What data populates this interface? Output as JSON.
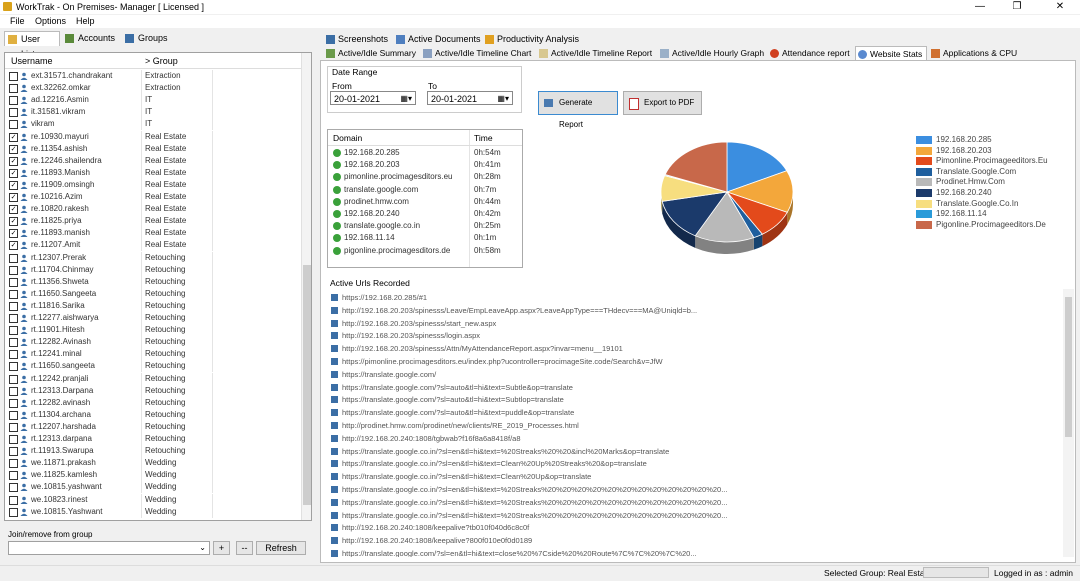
{
  "window": {
    "title": "WorkTrak - On Premises- Manager [ Licensed ]",
    "min": "—",
    "max": "❐",
    "close": "✕"
  },
  "menu": [
    "File",
    "Options",
    "Help"
  ],
  "left_tabs": [
    "User List",
    "Accounts",
    "Groups"
  ],
  "user_list": {
    "columns": [
      "Username",
      "> Group"
    ],
    "rows": [
      {
        "name": "ext.31571.chandrakant",
        "group": "Extraction",
        "checked": false
      },
      {
        "name": "ext.32262.omkar",
        "group": "Extraction",
        "checked": false
      },
      {
        "name": "ad.12216.Asmin",
        "group": "IT",
        "checked": false
      },
      {
        "name": "it.31581.vikram",
        "group": "IT",
        "checked": false
      },
      {
        "name": "vikram",
        "group": "IT",
        "checked": false
      },
      {
        "name": "re.10930.mayuri",
        "group": "Real Estate",
        "checked": true
      },
      {
        "name": "re.11354.ashish",
        "group": "Real Estate",
        "checked": true
      },
      {
        "name": "re.12246.shailendra",
        "group": "Real Estate",
        "checked": true
      },
      {
        "name": "re.11893.Manish",
        "group": "Real Estate",
        "checked": true
      },
      {
        "name": "re.11909.omsingh",
        "group": "Real Estate",
        "checked": true
      },
      {
        "name": "re.10216.Azim",
        "group": "Real Estate",
        "checked": true
      },
      {
        "name": "re.10820.rakesh",
        "group": "Real Estate",
        "checked": true
      },
      {
        "name": "re.11825.priya",
        "group": "Real Estate",
        "checked": true
      },
      {
        "name": "re.11893.manish",
        "group": "Real Estate",
        "checked": true
      },
      {
        "name": "re.11207.Amit",
        "group": "Real Estate",
        "checked": true
      },
      {
        "name": "rt.12307.Prerak",
        "group": "Retouching",
        "checked": false
      },
      {
        "name": "rt.11704.Chinmay",
        "group": "Retouching",
        "checked": false
      },
      {
        "name": "rt.11356.Shweta",
        "group": "Retouching",
        "checked": false
      },
      {
        "name": "rt.11650.Sangeeta",
        "group": "Retouching",
        "checked": false
      },
      {
        "name": "rt.11816.Sarika",
        "group": "Retouching",
        "checked": false
      },
      {
        "name": "rt.12277.aishwarya",
        "group": "Retouching",
        "checked": false
      },
      {
        "name": "rt.11901.Hitesh",
        "group": "Retouching",
        "checked": false
      },
      {
        "name": "rt.12282.Avinash",
        "group": "Retouching",
        "checked": false
      },
      {
        "name": "rt.12241.minal",
        "group": "Retouching",
        "checked": false
      },
      {
        "name": "rt.11650.sangeeta",
        "group": "Retouching",
        "checked": false
      },
      {
        "name": "rt.12242.pranjali",
        "group": "Retouching",
        "checked": false
      },
      {
        "name": "rt.12313.Darpana",
        "group": "Retouching",
        "checked": false
      },
      {
        "name": "rt.12282.avinash",
        "group": "Retouching",
        "checked": false
      },
      {
        "name": "rt.11304.archana",
        "group": "Retouching",
        "checked": false
      },
      {
        "name": "rt.12207.harshada",
        "group": "Retouching",
        "checked": false
      },
      {
        "name": "rt.12313.darpana",
        "group": "Retouching",
        "checked": false
      },
      {
        "name": "rt.11913.Swarupa",
        "group": "Retouching",
        "checked": false
      },
      {
        "name": "we.11871.prakash",
        "group": "Wedding",
        "checked": false
      },
      {
        "name": "we.11825.kamlesh",
        "group": "Wedding",
        "checked": false
      },
      {
        "name": "we.10815.yashwant",
        "group": "Wedding",
        "checked": false
      },
      {
        "name": "we.10823.rinest",
        "group": "Wedding",
        "checked": false
      },
      {
        "name": "we.10815.Yashwant",
        "group": "Wedding",
        "checked": false
      }
    ]
  },
  "join": {
    "label": "Join/remove from group",
    "plus": "+",
    "minus": "--",
    "refresh": "Refresh"
  },
  "top_nav": [
    "Screenshots",
    "Active Documents",
    "Productivity Analysis"
  ],
  "report_tabs": [
    "Active/Idle Summary",
    "Active/Idle Timeline Chart",
    "Active/Idle Timeline Report",
    "Active/Idle Hourly Graph",
    "Attendance report",
    "Website Stats",
    "Applications & CPU"
  ],
  "date_range": {
    "label": "Date Range",
    "from_label": "From",
    "to_label": "To",
    "from": "20-01-2021",
    "to": "20-01-2021"
  },
  "buttons": {
    "generate": "Generate Report",
    "export": "Export to PDF"
  },
  "domain_table": {
    "columns": [
      "Domain",
      "Time"
    ],
    "rows": [
      {
        "domain": "192.168.20.285",
        "time": "0h:54m"
      },
      {
        "domain": "192.168.20.203",
        "time": "0h:41m"
      },
      {
        "domain": "pimonline.procimagesditors.eu",
        "time": "0h:28m"
      },
      {
        "domain": "translate.google.com",
        "time": "0h:7m"
      },
      {
        "domain": "prodinet.hmw.com",
        "time": "0h:44m"
      },
      {
        "domain": "192.168.20.240",
        "time": "0h:42m"
      },
      {
        "domain": "translate.google.co.in",
        "time": "0h:25m"
      },
      {
        "domain": "192.168.11.14",
        "time": "0h:1m"
      },
      {
        "domain": "pigonline.procimagesditors.de",
        "time": "0h:58m"
      }
    ]
  },
  "urls": {
    "label": "Active Urls Recorded",
    "items": [
      "https://192.168.20.285/#1",
      "http://192.168.20.203/spinesss/Leave/EmpLeaveApp.aspx?LeaveAppType===THdecv===MA@Uniqld=b...",
      "http://192.168.20.203/spinesss/start_new.aspx",
      "http://192.168.20.203/spinesss/login.aspx",
      "http://192.168.20.203/spinesss/Attn/MyAttendanceReport.aspx?invar=menu__19101",
      "https://pimonline.procimagesditors.eu/index.php?ucontroller=procimageSite.code/Search&v=JfW",
      "https://translate.google.com/",
      "https://translate.google.com/?sl=auto&tl=hi&text=Subtle&op=translate",
      "https://translate.google.com/?sl=auto&tl=hi&text=Subtlop=translate",
      "https://translate.google.com/?sl=auto&tl=hi&text=puddle&op=translate",
      "http://prodinet.hmw.com/prodinet/new/clients/RE_2019_Processes.html",
      "http://192.168.20.240:1808/tgbwab?f16f8a6a8418f/a8",
      "https://translate.google.co.in/?sl=en&tl=hi&text=%20Streaks%20%20&incl%20Marks&op=translate",
      "https://translate.google.co.in/?sl=en&tl=hi&text=Clean%20Up%20Streaks%20&op=translate",
      "https://translate.google.co.in/?sl=en&tl=hi&text=Clean%20Up&op=translate",
      "https://translate.google.co.in/?sl=en&tl=hi&text=%20Streaks%20%20%20%20%20%20%20%20%20%20%20%20...",
      "https://translate.google.co.in/?sl=en&tl=hi&text=%20Streaks%20%20%20%20%20%20%20%20%20%20%20%20...",
      "https://translate.google.co.in/?sl=en&tl=hi&text=%20Streaks%20%20%20%20%20%20%20%20%20%20%20%20...",
      "http://192.168.20.240:1808/keepalive?tb010f040d6c8c0f",
      "http://192.168.20.240:1808/keepalive?800f010e0f0d0189",
      "https://translate.google.com/?sl=en&tl=hi&text=close%20%7Cside%20%20Route%7C%7C%20%7C%20..."
    ]
  },
  "chart_data": {
    "type": "pie",
    "categories": [
      "192.168.20.285",
      "192.168.20.203",
      "Pimonline.Procimageeditors.Eu",
      "Translate.Google.Com",
      "Prodinet.Hmw.Com",
      "192.168.20.240",
      "Translate.Google.Co.In",
      "192.168.11.14",
      "Pigonline.Procimageeditors.De"
    ],
    "values": [
      54,
      41,
      28,
      7,
      44,
      42,
      25,
      1,
      58
    ],
    "colors": [
      "#3b8ee0",
      "#f3a73b",
      "#e34a1b",
      "#1f5f9e",
      "#b9b9b9",
      "#1b3a6b",
      "#f7de7f",
      "#2a9bd9",
      "#c8684a"
    ],
    "legend": "right"
  },
  "status": {
    "selected_group": "Selected Group: Real Estate",
    "logged_in": "Logged in as : admin"
  }
}
